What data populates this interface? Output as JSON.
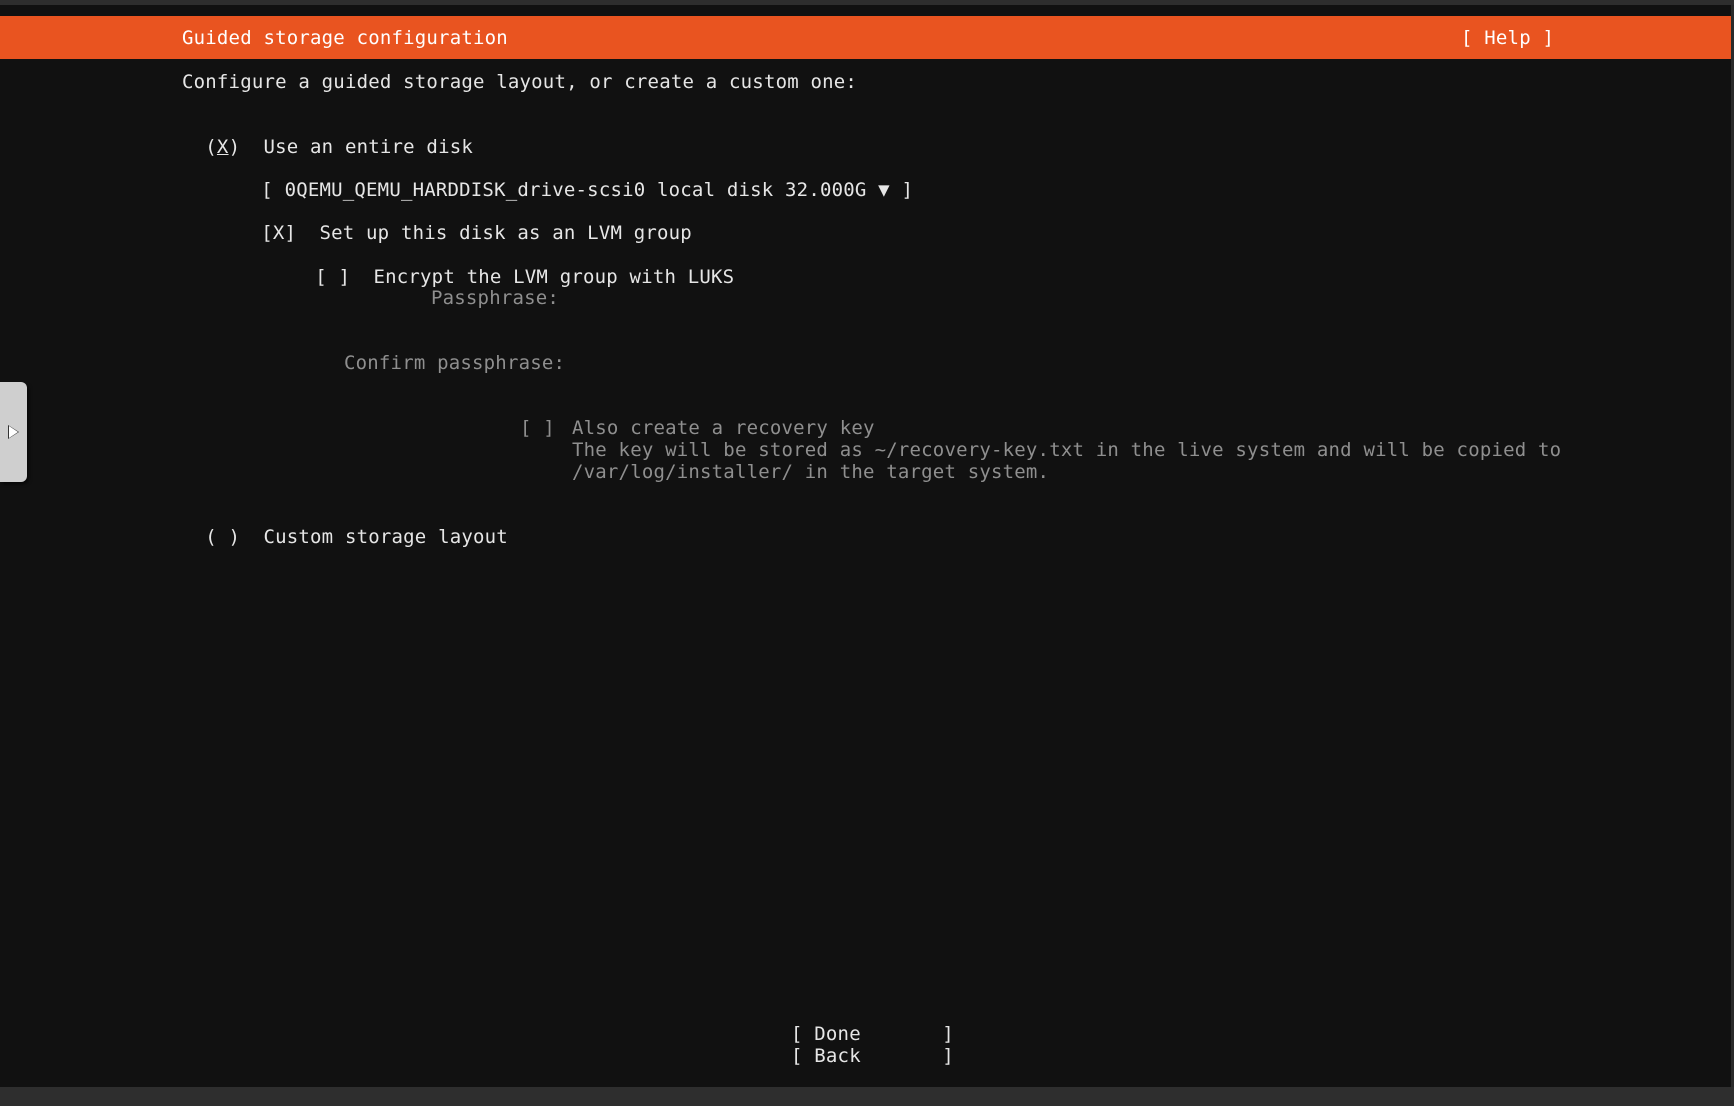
{
  "header": {
    "title": "Guided storage configuration",
    "help_label": "[ Help ]"
  },
  "intro": "Configure a guided storage layout, or create a custom one:",
  "entire_disk": {
    "radio_open": "(",
    "radio_mark": "X",
    "radio_close": ")",
    "label": "Use an entire disk"
  },
  "disk_select": {
    "open": "[",
    "value": "0QEMU_QEMU_HARDDISK_drive-scsi0 local disk 32.000G",
    "arrow": "▼",
    "close": "]"
  },
  "lvm": {
    "checkbox": "[X]",
    "label": "Set up this disk as an LVM group"
  },
  "luks": {
    "checkbox": "[ ]",
    "label": "Encrypt the LVM group with LUKS"
  },
  "passphrase": {
    "label": "Passphrase:",
    "value": ""
  },
  "confirm_passphrase": {
    "label": "Confirm passphrase:",
    "value": ""
  },
  "recovery_key": {
    "checkbox": "[ ]",
    "label": "Also create a recovery key",
    "desc_line1": "The key will be stored as ~/recovery-key.txt in the live system and will be copied to",
    "desc_line2": "/var/log/installer/ in the target system."
  },
  "custom_layout": {
    "radio": "( )",
    "label": "Custom storage layout"
  },
  "buttons": {
    "done": "[ Done       ]",
    "back": "[ Back       ]"
  },
  "colors": {
    "accent": "#e95420",
    "background": "#111111",
    "text": "#e6e6e6",
    "disabled_text": "#8f8f8f"
  },
  "icons": {
    "side_tab": "play-arrow-icon"
  }
}
